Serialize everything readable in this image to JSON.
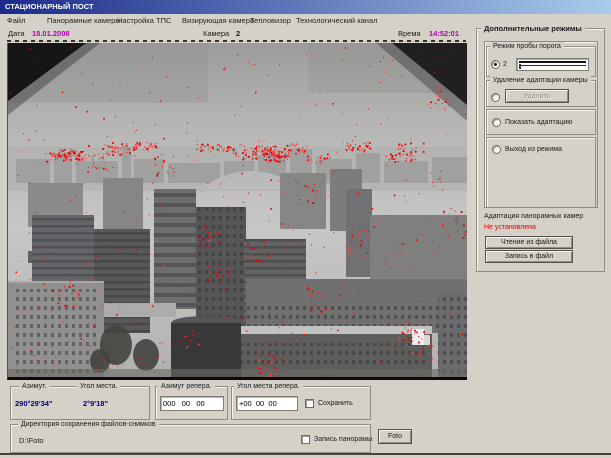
{
  "window": {
    "title": "СТАЦИОНАРНЫЙ ПОСТ"
  },
  "menu": {
    "items": [
      "Файл",
      "Панорамные камеры",
      "Настройка ТПС",
      "Визирующая камера",
      "Тепловизор",
      "Технологический канал"
    ]
  },
  "info_bar": {
    "date_label": "Дата",
    "date_value": "18.01.2008",
    "camera_label": "Камера",
    "camera_value": "2",
    "time_label": "Время",
    "time_value": "14:52:01"
  },
  "camera_view": {
    "name": "thermal-city-panorama"
  },
  "right_panel": {
    "title": "Дополнительные режимы",
    "threshold": {
      "label": "Режим пробы порога",
      "value": "2"
    },
    "removal": {
      "label": "Удаление адаптации камеры",
      "button": "Удалить"
    },
    "show_adaptation_label": "Показать адаптацию",
    "exit_mode_label": "Выход из режима",
    "adaptation_caption": "Адаптация панорамных камер",
    "adaptation_status": "Не установлена",
    "read_file_button": "Чтение из файла",
    "write_file_button": "Запись в файл"
  },
  "measurements": {
    "azimuth_label": "Азимут.",
    "azimuth_value": "290°29'34\"",
    "elevation_label": "Угол места.",
    "elevation_value": "2°9'18\"",
    "ref_azimuth_label": "Азимут репера.",
    "ref_azimuth_value": "000   00   00",
    "ref_elevation_label": "Угол места репера.",
    "ref_elevation_value": "+00  00  00",
    "save_label": "Сохранить"
  },
  "directory": {
    "label": "Директория сохранения файлов-снимков",
    "path": "D:\\Foto",
    "record_panorama_label": "Запись панорамы",
    "photo_button": "Foto"
  },
  "colors": {
    "accent_magenta": "#b400b4",
    "status_red": "#e00000",
    "value_navy": "#000080",
    "titlebar_from": "#1b2a8a",
    "titlebar_to": "#a8ccec",
    "detection_red": "#ff0000"
  }
}
